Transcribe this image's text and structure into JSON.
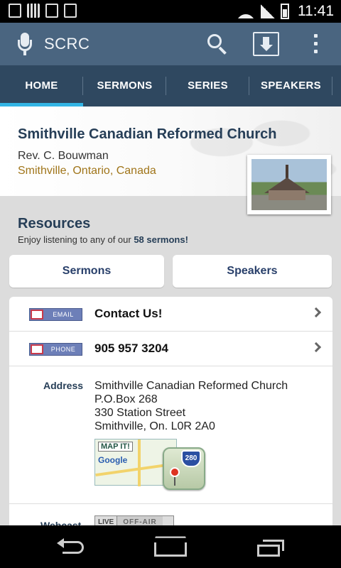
{
  "status_bar": {
    "time": "11:41"
  },
  "app_bar": {
    "title": "SCRC"
  },
  "tabs": [
    {
      "label": "HOME",
      "active": true
    },
    {
      "label": "SERMONS"
    },
    {
      "label": "SERIES"
    },
    {
      "label": "SPEAKERS"
    }
  ],
  "header": {
    "church_name": "Smithville Canadian Reformed Church",
    "pastor": "Rev. C. Bouwman",
    "location": "Smithville, Ontario, Canada"
  },
  "resources": {
    "title": "Resources",
    "subtitle_prefix": "Enjoy listening to any of our ",
    "subtitle_count": "58 sermons!",
    "buttons": {
      "sermons": "Sermons",
      "speakers": "Speakers"
    }
  },
  "contact": {
    "email_chip": "EMAIL",
    "email_text": "Contact Us!",
    "phone_chip": "PHONE",
    "phone_text": "905 957 3204",
    "address_label": "Address",
    "address_lines": [
      "Smithville Canadian Reformed Church",
      "P.O.Box 268",
      "330 Station Street",
      "Smithville, On. L0R 2A0"
    ],
    "map_title": "MAP IT!",
    "map_brand": "Google",
    "map_route": "280",
    "webcast_label": "Webcast",
    "live_label": "LIVE",
    "off_air_label": "OFF-AIR"
  },
  "colors": {
    "app_bar": "#4a6580",
    "tabs_bg": "#2f4860",
    "tab_indicator": "#33b5e5",
    "heading": "#263e57",
    "location": "#a0751a"
  }
}
